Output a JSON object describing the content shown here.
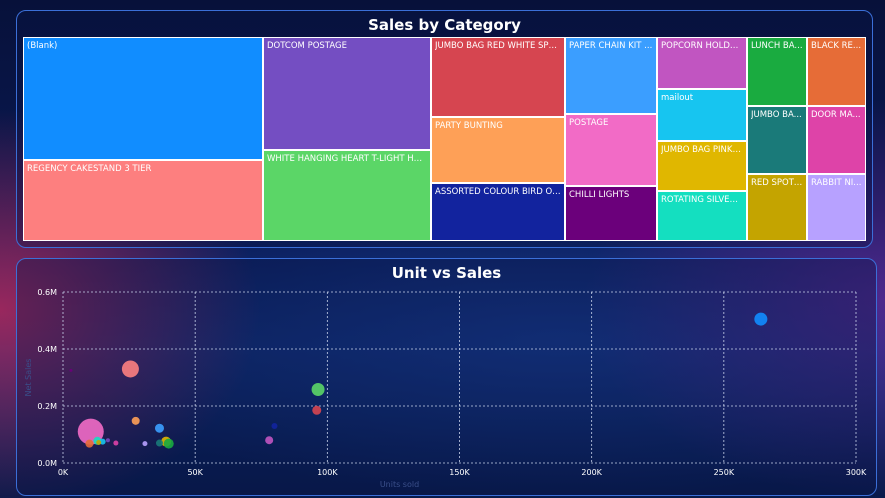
{
  "treemap": {
    "title": "Sales by Category",
    "tiles": [
      {
        "label": "(Blank)",
        "color": "#118dff"
      },
      {
        "label": "REGENCY CAKESTAND 3 TIER",
        "color": "#fd7f7f"
      },
      {
        "label": "DOTCOM POSTAGE",
        "color": "#744ec2"
      },
      {
        "label": "WHITE HANGING HEART T-LIGHT HO...",
        "color": "#5bd667"
      },
      {
        "label": "JUMBO BAG RED WHITE SPO...",
        "color": "#d64550"
      },
      {
        "label": "PARTY BUNTING",
        "color": "#fea057"
      },
      {
        "label": "ASSORTED COLOUR BIRD OR...",
        "color": "#12239e"
      },
      {
        "label": "PAPER CHAIN KIT ...",
        "color": "#3b9eff"
      },
      {
        "label": "POSTAGE",
        "color": "#f26bc6"
      },
      {
        "label": "CHILLI LIGHTS",
        "color": "#6b007b"
      },
      {
        "label": "POPCORN HOLDE...",
        "color": "#c155c1"
      },
      {
        "label": "mailout",
        "color": "#17c5f0"
      },
      {
        "label": "JUMBO BAG PINK ...",
        "color": "#e0b700"
      },
      {
        "label": "ROTATING SILVER ...",
        "color": "#14dfc0"
      },
      {
        "label": "LUNCH BA...",
        "color": "#1aab40"
      },
      {
        "label": "JUMBO BA...",
        "color": "#1a7a79"
      },
      {
        "label": "RED SPOTT...",
        "color": "#c4a400"
      },
      {
        "label": "BLACK RE...",
        "color": "#e66c37"
      },
      {
        "label": "DOOR MA...",
        "color": "#de43a8"
      },
      {
        "label": "RABBIT NI...",
        "color": "#b7a1ff"
      }
    ]
  },
  "chart_data": {
    "type": "scatter",
    "title": "Unit vs Sales",
    "xlabel": "Units sold",
    "ylabel": "Net Sales",
    "xlim": [
      0,
      300000
    ],
    "ylim": [
      0,
      600000
    ],
    "grid": true,
    "x_ticks": [
      "0K",
      "50K",
      "100K",
      "150K",
      "200K",
      "250K",
      "300K"
    ],
    "y_ticks": [
      "0.0M",
      "0.2M",
      "0.4M",
      "0.6M"
    ],
    "points": [
      {
        "x": 264000,
        "y": 505000,
        "size": 13,
        "color": "#118dff"
      },
      {
        "x": 25500,
        "y": 330000,
        "size": 17,
        "color": "#fd7f7f"
      },
      {
        "x": 96500,
        "y": 258000,
        "size": 13,
        "color": "#5bd667"
      },
      {
        "x": 96000,
        "y": 185000,
        "size": 9,
        "color": "#d64550"
      },
      {
        "x": 80000,
        "y": 130000,
        "size": 6,
        "color": "#12239e"
      },
      {
        "x": 78000,
        "y": 80000,
        "size": 8,
        "color": "#c155c1"
      },
      {
        "x": 10500,
        "y": 110000,
        "size": 26,
        "color": "#f26bc6"
      },
      {
        "x": 27500,
        "y": 148000,
        "size": 8,
        "color": "#fea057"
      },
      {
        "x": 36500,
        "y": 122000,
        "size": 9,
        "color": "#3b9eff"
      },
      {
        "x": 39000,
        "y": 75000,
        "size": 10,
        "color": "#e0b700"
      },
      {
        "x": 40000,
        "y": 68000,
        "size": 10,
        "color": "#1aab40"
      },
      {
        "x": 36500,
        "y": 70000,
        "size": 7,
        "color": "#1a7a79"
      },
      {
        "x": 31000,
        "y": 68000,
        "size": 5,
        "color": "#b7a1ff"
      },
      {
        "x": 13000,
        "y": 78000,
        "size": 8,
        "color": "#14dfc0"
      },
      {
        "x": 15000,
        "y": 75000,
        "size": 6,
        "color": "#17c5f0"
      },
      {
        "x": 10000,
        "y": 68000,
        "size": 8,
        "color": "#e66c37"
      },
      {
        "x": 20000,
        "y": 70000,
        "size": 5,
        "color": "#de43a8"
      },
      {
        "x": 17000,
        "y": 80000,
        "size": 4,
        "color": "#744ec2"
      },
      {
        "x": 3000,
        "y": 325000,
        "size": 3,
        "color": "#6b007b"
      },
      {
        "x": 13500,
        "y": 72000,
        "size": 5,
        "color": "#c4a400"
      }
    ]
  }
}
